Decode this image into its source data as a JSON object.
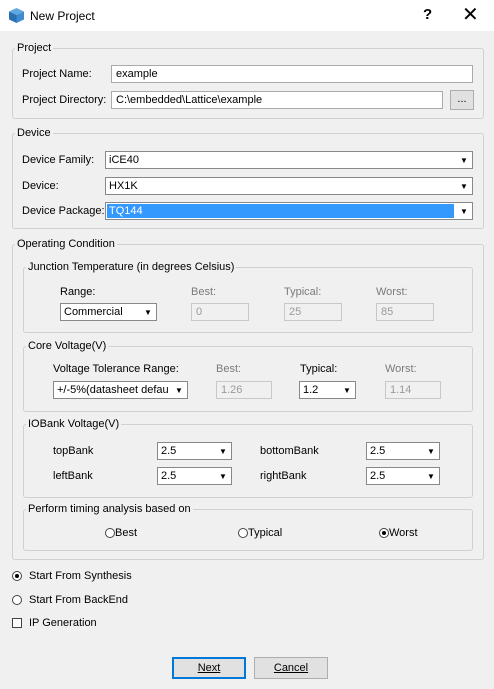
{
  "window": {
    "title": "New Project",
    "help": "?",
    "close": "✕"
  },
  "project": {
    "legend": "Project",
    "name_label": "Project Name:",
    "name_value": "example",
    "dir_label": "Project Directory:",
    "dir_value": "C:\\embedded\\Lattice\\example",
    "browse_label": "..."
  },
  "device": {
    "legend": "Device",
    "family_label": "Device Family:",
    "family_value": "iCE40",
    "device_label": "Device:",
    "device_value": "HX1K",
    "package_label": "Device Package:",
    "package_value": "TQ144"
  },
  "operating": {
    "legend": "Operating Condition",
    "junction": {
      "legend": "Junction Temperature (in degrees Celsius)",
      "range_label": "Range:",
      "range_value": "Commercial",
      "best_label": "Best:",
      "best_value": "0",
      "typical_label": "Typical:",
      "typical_value": "25",
      "worst_label": "Worst:",
      "worst_value": "85"
    },
    "core": {
      "legend": "Core Voltage(V)",
      "tolerance_label": "Voltage Tolerance Range:",
      "tolerance_value": "+/-5%(datasheet defau",
      "best_label": "Best:",
      "best_value": "1.26",
      "typical_label": "Typical:",
      "typical_value": "1.2",
      "worst_label": "Worst:",
      "worst_value": "1.14"
    },
    "iobank": {
      "legend": "IOBank Voltage(V)",
      "top_label": "topBank",
      "top_value": "2.5",
      "bottom_label": "bottomBank",
      "bottom_value": "2.5",
      "left_label": "leftBank",
      "left_value": "2.5",
      "right_label": "rightBank",
      "right_value": "2.5"
    },
    "timing": {
      "legend": "Perform timing analysis based on",
      "best": "Best",
      "typical": "Typical",
      "worst": "Worst",
      "selected": "Worst"
    }
  },
  "start": {
    "synthesis": "Start From Synthesis",
    "backend": "Start From BackEnd",
    "ip": "IP Generation",
    "selected": "Start From Synthesis"
  },
  "buttons": {
    "next": "Next",
    "cancel": "Cancel"
  }
}
